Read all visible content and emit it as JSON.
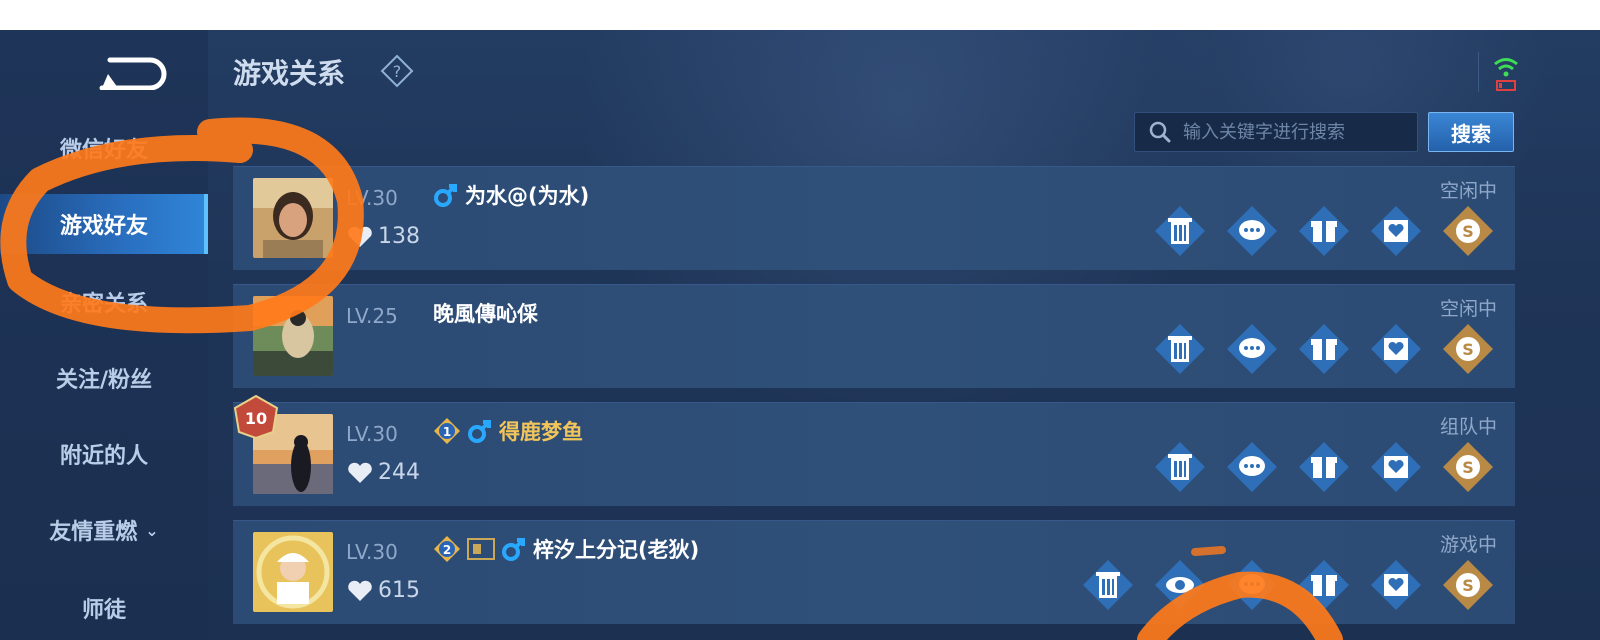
{
  "header": {
    "title": "游戏关系"
  },
  "sidebar": {
    "items": [
      {
        "label": "微信好友",
        "active": false
      },
      {
        "label": "游戏好友",
        "active": true
      },
      {
        "label": "亲密关系",
        "active": false
      },
      {
        "label": "关注/粉丝",
        "active": false
      },
      {
        "label": "附近的人",
        "active": false
      },
      {
        "label": "友情重燃",
        "active": false,
        "chevron": "chevron-down-icon"
      },
      {
        "label": "师徒",
        "active": false
      }
    ]
  },
  "search": {
    "placeholder": "输入关键字进行搜索",
    "button_label": "搜索"
  },
  "friends": [
    {
      "level": "LV.30",
      "name": "为水@(为水)",
      "hearts": "138",
      "status": "空闲中",
      "gender_icon": "male-icon"
    },
    {
      "level": "LV.25",
      "name": "晚風傳吣倸",
      "hearts": "",
      "status": "空闲中"
    },
    {
      "level": "LV.30",
      "name": "得鹿梦鱼",
      "hearts": "244",
      "status": "组队中",
      "rank": "1",
      "gender_icon": "male-icon",
      "avatar_badge": "10"
    },
    {
      "level": "LV.30",
      "name": "梓汐上分记(老狄)",
      "hearts": "615",
      "status": "游戏中",
      "rank": "2",
      "gender_icon": "male-icon"
    }
  ],
  "action_icons": [
    "trash-icon",
    "chat-icon",
    "gift-icon",
    "intimacy-card-icon",
    "gold-coin-icon"
  ],
  "colors": {
    "background": "#1f3558",
    "row": "#2d4d76",
    "accent": "#2f86d8",
    "highlight_scribble": "#ff7a1a",
    "male": "#29a8ff",
    "gold_name": "#f2c55a"
  }
}
